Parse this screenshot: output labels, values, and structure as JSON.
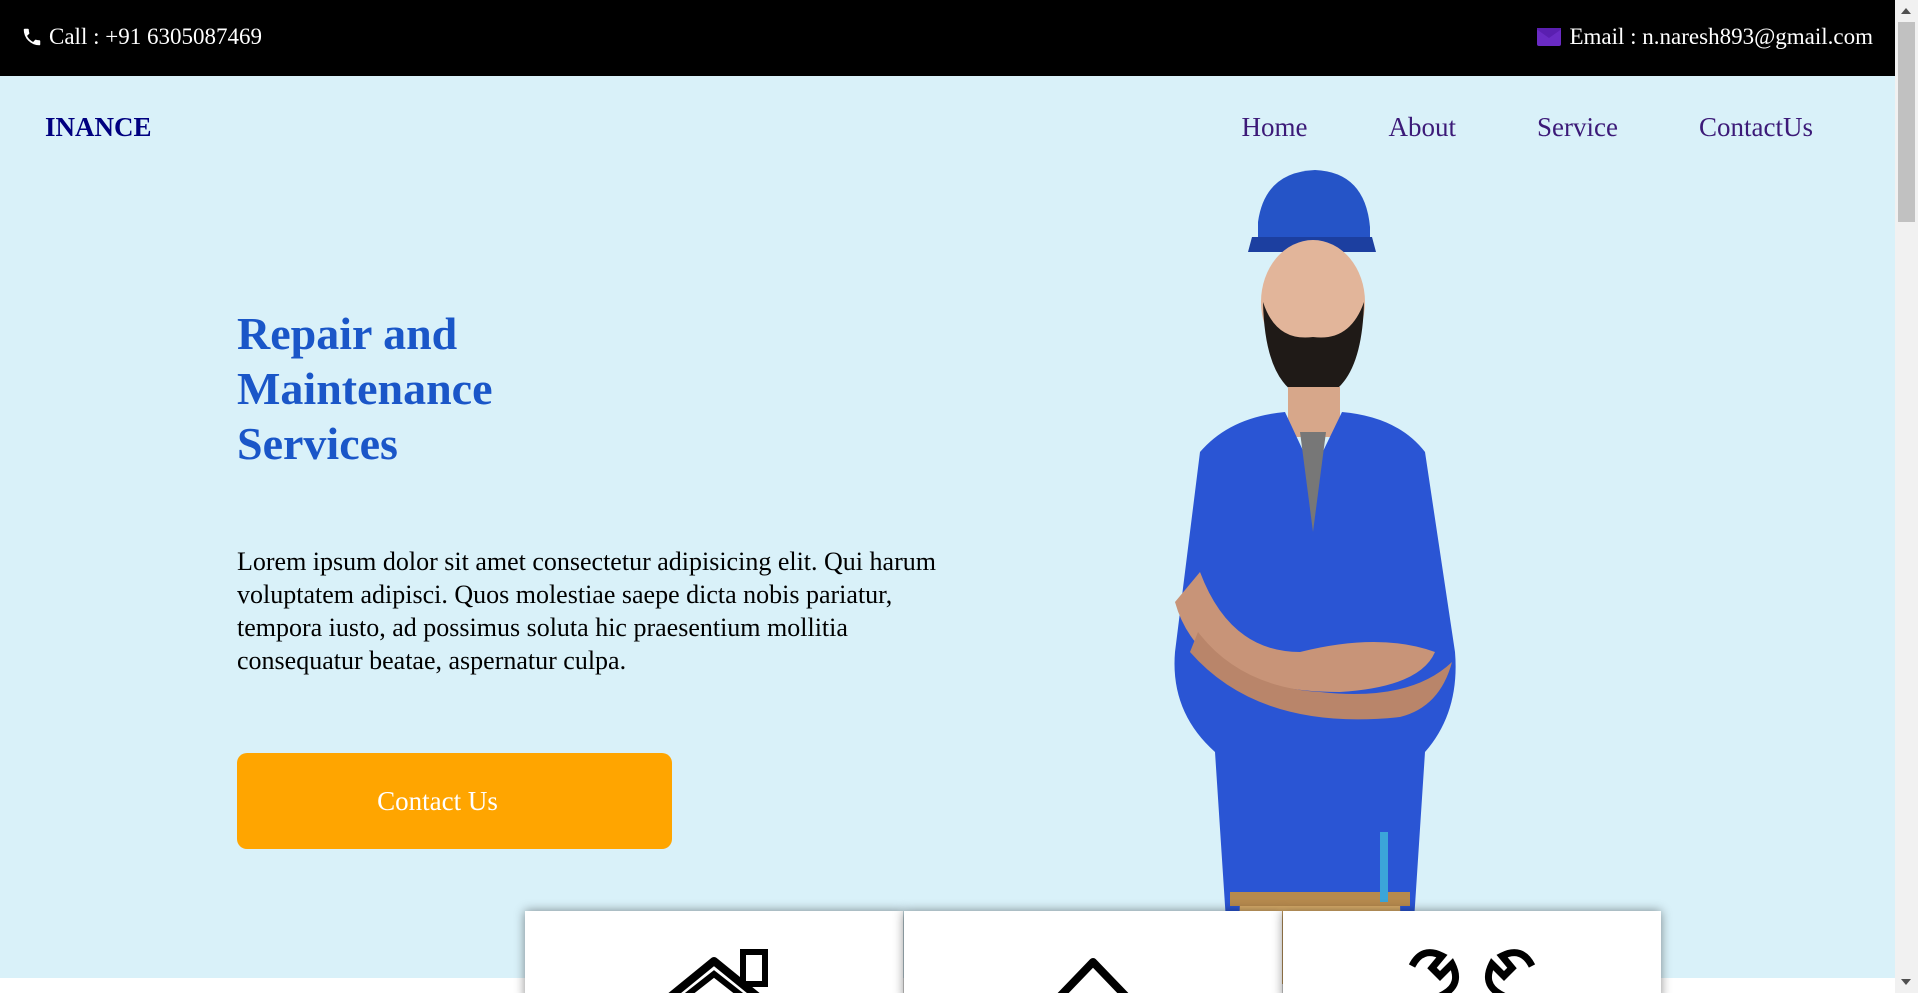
{
  "topbar": {
    "call_text": "Call : +91 6305087469",
    "email_text": "Email : n.naresh893@gmail.com",
    "phone_icon": "phone-icon",
    "email_icon": "envelope-icon"
  },
  "header": {
    "logo": "INANCE",
    "nav": [
      "Home",
      "About",
      "Service",
      "ContactUs"
    ]
  },
  "hero": {
    "title": "Repair and Maintenance Services",
    "description": "Lorem ipsum dolor sit amet consectetur adipisicing elit. Qui harum voluptatem adipisci. Quos molestiae saepe dicta nobis pariatur, tempora iusto, ad possimus soluta hic praesentium mollitia consequatur beatae, aspernatur culpa.",
    "cta_label": "Contact Us",
    "image": "repairman-photo"
  },
  "cards": [
    {
      "icon": "house-chimney-icon"
    },
    {
      "icon": "house-icon"
    },
    {
      "icon": "wrench-tools-icon"
    }
  ],
  "colors": {
    "topbar_bg": "#000000",
    "hero_bg": "#d9f1f9",
    "logo": "#000080",
    "nav": "#3c1a78",
    "title": "#1a56c8",
    "cta": "#ffa500",
    "email_icon": "#6a2bc4"
  }
}
